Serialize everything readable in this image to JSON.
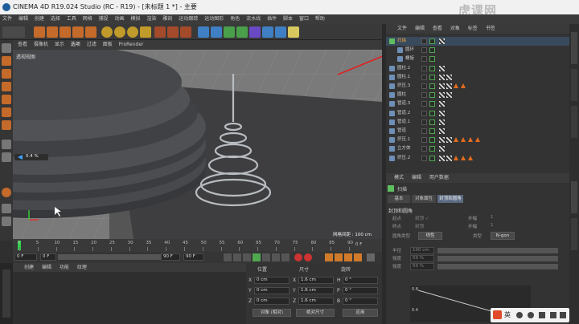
{
  "app": {
    "title": "CINEMA 4D R19.024 Studio (RC - R19) - [未标题 1 *] - 主要",
    "watermark": "虎课网"
  },
  "menu": [
    "文件",
    "编辑",
    "创建",
    "选择",
    "工具",
    "网格",
    "捕捉",
    "动画",
    "模拟",
    "渲染",
    "雕刻",
    "运动跟踪",
    "运动图形",
    "角色",
    "流水线",
    "插件",
    "脚本",
    "窗口",
    "帮助"
  ],
  "viewport": {
    "menu": [
      "查看",
      "摄像机",
      "显示",
      "选项",
      "过滤",
      "面板",
      "ProRender"
    ],
    "camera_label": "透视视图",
    "grid_distance": "网格间距 : 100 cm",
    "percent_label": "0.4 %"
  },
  "timeline": {
    "ticks": [
      "0",
      "5",
      "10",
      "15",
      "20",
      "25",
      "30",
      "35",
      "40",
      "45",
      "50",
      "55",
      "60",
      "65",
      "70",
      "75",
      "80",
      "85",
      "90"
    ],
    "end_frame": "0 F"
  },
  "transport": {
    "start": "0 F",
    "current": "0 F",
    "end_a": "90 F",
    "end_b": "90 F"
  },
  "material_menu": [
    "创建",
    "编辑",
    "功能",
    "纹理"
  ],
  "coords": {
    "headers": {
      "position": "位置",
      "size": "尺寸",
      "rotation": "旋转"
    },
    "rows": [
      {
        "axis": "X",
        "pos": "0 cm",
        "size": "1.6 cm",
        "rot_axis": "H",
        "rot": "0 °"
      },
      {
        "axis": "Y",
        "pos": "0 cm",
        "size": "1.6 cm",
        "rot_axis": "P",
        "rot": "0 °"
      },
      {
        "axis": "Z",
        "pos": "0 cm",
        "size": "1.6 cm",
        "rot_axis": "B",
        "rot": "0 °"
      }
    ],
    "mode_object": "对象 (相对)",
    "mode_size": "绝对尺寸",
    "apply": "应用"
  },
  "object_manager": {
    "tabs": [
      "文件",
      "编辑",
      "查看",
      "对象",
      "标签",
      "书签"
    ],
    "objects": [
      {
        "name": "扫描",
        "icon_color": "#5fbf5f",
        "selected": true,
        "tags": [
          "checker"
        ]
      },
      {
        "name": "圆环",
        "icon_color": "#6f8fb7",
        "selected": false,
        "tags": []
      },
      {
        "name": "螺旋",
        "icon_color": "#6f8fb7",
        "selected": false,
        "tags": []
      },
      {
        "name": "圆柱.2",
        "icon_color": "#6f8fb7",
        "selected": false,
        "tags": [
          "checker"
        ]
      },
      {
        "name": "圆柱.1",
        "icon_color": "#6f8fb7",
        "selected": false,
        "tags": [
          "checker",
          "checker"
        ]
      },
      {
        "name": "挤压.3",
        "icon_color": "#6f8fb7",
        "selected": false,
        "tags": [
          "checker",
          "checker",
          "tri",
          "tri"
        ]
      },
      {
        "name": "圆柱",
        "icon_color": "#6f8fb7",
        "selected": false,
        "tags": [
          "checker",
          "checker"
        ]
      },
      {
        "name": "管道.3",
        "icon_color": "#6f8fb7",
        "selected": false,
        "tags": [
          "checker"
        ]
      },
      {
        "name": "管道.2",
        "icon_color": "#6f8fb7",
        "selected": false,
        "tags": [
          "checker"
        ]
      },
      {
        "name": "管道.1",
        "icon_color": "#6f8fb7",
        "selected": false,
        "tags": [
          "checker"
        ]
      },
      {
        "name": "管道",
        "icon_color": "#6f8fb7",
        "selected": false,
        "tags": [
          "checker"
        ]
      },
      {
        "name": "挤压.1",
        "icon_color": "#6f8fb7",
        "selected": false,
        "tags": [
          "checker",
          "checker",
          "tri",
          "tri",
          "tri",
          "tri"
        ]
      },
      {
        "name": "立方体",
        "icon_color": "#6f8fb7",
        "selected": false,
        "tags": [
          "checker"
        ]
      },
      {
        "name": "挤压.2",
        "icon_color": "#6f8fb7",
        "selected": false,
        "tags": [
          "checker",
          "checker",
          "tri",
          "tri",
          "tri"
        ]
      }
    ]
  },
  "attributes": {
    "tabs": [
      "模式",
      "编辑",
      "用户数据"
    ],
    "object_label": "扫描",
    "subtabs": [
      "基本",
      "对象属性",
      "封顶和圆角"
    ],
    "section": "封顶和圆角",
    "rows": [
      {
        "label": "起点",
        "value": "封顶 ✓"
      },
      {
        "label": "步幅",
        "value": "1"
      },
      {
        "label": "终点",
        "value": "封顶"
      },
      {
        "label": "步幅",
        "value": "1"
      },
      {
        "label": "圆角类型",
        "value": "线性"
      },
      {
        "label": "平滑着色",
        "value": ""
      },
      {
        "label": "外壳向内",
        "value": ""
      },
      {
        "label": "穿孔向内",
        "value": ""
      },
      {
        "label": "约束",
        "value": ""
      },
      {
        "label": "创建单一对象",
        "value": ""
      },
      {
        "label": "圆角UVW保持外形",
        "value": ""
      },
      {
        "label": "类型",
        "value": "N-gon"
      },
      {
        "label": "标准网格",
        "value": ""
      },
      {
        "label": "宽度",
        "value": "10 cm"
      }
    ],
    "bars": [
      {
        "label": "半径",
        "value": "100 cm"
      },
      {
        "label": "强度",
        "value": "50 %"
      },
      {
        "label": "强度",
        "value": "50 %"
      }
    ],
    "graph_tick": "0.4",
    "graph_tick2": "0.8"
  },
  "status": {
    "ime": "英"
  }
}
